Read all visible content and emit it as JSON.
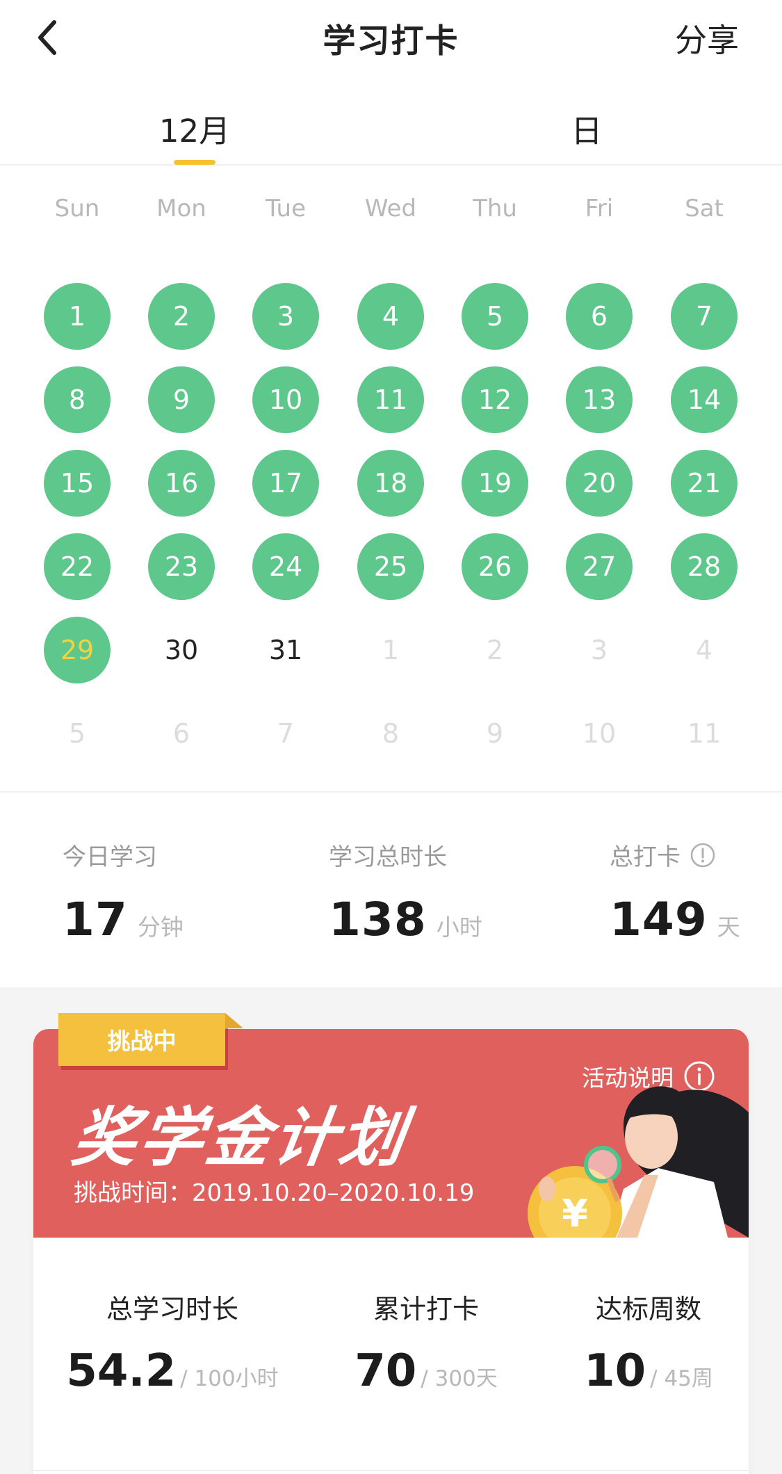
{
  "nav": {
    "title": "学习打卡",
    "share_label": "分享"
  },
  "tabs": [
    {
      "label": "12月"
    },
    {
      "label": "日"
    }
  ],
  "calendar": {
    "weekdays": [
      "Sun",
      "Mon",
      "Tue",
      "Wed",
      "Thu",
      "Fri",
      "Sat"
    ],
    "checked_color": "#5ec78b",
    "today_color": "#f4d23f",
    "rows": [
      [
        {
          "d": "1",
          "s": "checked"
        },
        {
          "d": "2",
          "s": "checked"
        },
        {
          "d": "3",
          "s": "checked"
        },
        {
          "d": "4",
          "s": "checked"
        },
        {
          "d": "5",
          "s": "checked"
        },
        {
          "d": "6",
          "s": "checked"
        },
        {
          "d": "7",
          "s": "checked"
        }
      ],
      [
        {
          "d": "8",
          "s": "checked"
        },
        {
          "d": "9",
          "s": "checked"
        },
        {
          "d": "10",
          "s": "checked"
        },
        {
          "d": "11",
          "s": "checked"
        },
        {
          "d": "12",
          "s": "checked"
        },
        {
          "d": "13",
          "s": "checked"
        },
        {
          "d": "14",
          "s": "checked"
        }
      ],
      [
        {
          "d": "15",
          "s": "checked"
        },
        {
          "d": "16",
          "s": "checked"
        },
        {
          "d": "17",
          "s": "checked"
        },
        {
          "d": "18",
          "s": "checked"
        },
        {
          "d": "19",
          "s": "checked"
        },
        {
          "d": "20",
          "s": "checked"
        },
        {
          "d": "21",
          "s": "checked"
        }
      ],
      [
        {
          "d": "22",
          "s": "checked"
        },
        {
          "d": "23",
          "s": "checked"
        },
        {
          "d": "24",
          "s": "checked"
        },
        {
          "d": "25",
          "s": "checked"
        },
        {
          "d": "26",
          "s": "checked"
        },
        {
          "d": "27",
          "s": "checked"
        },
        {
          "d": "28",
          "s": "checked"
        }
      ],
      [
        {
          "d": "29",
          "s": "today"
        },
        {
          "d": "30",
          "s": "plain"
        },
        {
          "d": "31",
          "s": "plain"
        },
        {
          "d": "1",
          "s": "other"
        },
        {
          "d": "2",
          "s": "other"
        },
        {
          "d": "3",
          "s": "other"
        },
        {
          "d": "4",
          "s": "other"
        }
      ],
      [
        {
          "d": "5",
          "s": "other"
        },
        {
          "d": "6",
          "s": "other"
        },
        {
          "d": "7",
          "s": "other"
        },
        {
          "d": "8",
          "s": "other"
        },
        {
          "d": "9",
          "s": "other"
        },
        {
          "d": "10",
          "s": "other"
        },
        {
          "d": "11",
          "s": "other"
        }
      ]
    ]
  },
  "stats": {
    "today": {
      "label": "今日学习",
      "value": "17",
      "unit": "分钟"
    },
    "total_time": {
      "label": "学习总时长",
      "value": "138",
      "unit": "小时"
    },
    "total_checkin": {
      "label": "总打卡",
      "value": "149",
      "unit": "天",
      "icon": "info-icon"
    }
  },
  "challenge": {
    "badge": "挑战中",
    "activity_link": "活动说明",
    "title": "奖学金计划",
    "period": "挑战时间：2019.10.20–2020.10.19",
    "banner_color": "#e0605d",
    "badge_color": "#f5c03d",
    "coin_symbol": "¥",
    "stats": [
      {
        "label": "总学习时长",
        "value": "54.2",
        "total": "/ 100小时"
      },
      {
        "label": "累计打卡",
        "value": "70",
        "total": "/ 300天"
      },
      {
        "label": "达标周数",
        "value": "10",
        "total": "/ 45周"
      }
    ]
  }
}
